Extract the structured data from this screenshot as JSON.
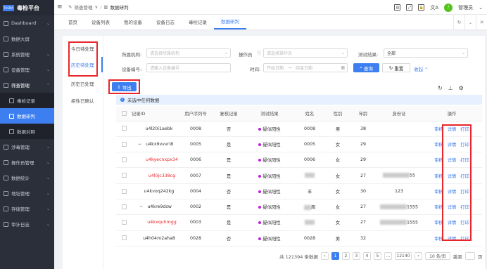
{
  "sidebar": {
    "logo_text": "TUSMA",
    "brand_title": "毒检平台",
    "items": [
      {
        "label": "Dashboard",
        "chev": "⌄"
      },
      {
        "label": "数据大屏",
        "chev": ""
      },
      {
        "label": "系统管理",
        "chev": "⌄"
      },
      {
        "label": "设备管理",
        "chev": "⌄"
      },
      {
        "label": "筛查管理",
        "chev": "⌃"
      },
      {
        "label": "毒检记录",
        "chev": ""
      },
      {
        "label": "数据研判",
        "chev": ""
      },
      {
        "label": "数据对照",
        "chev": ""
      },
      {
        "label": "涉毒管理",
        "chev": "⌄"
      },
      {
        "label": "操作员管理",
        "chev": "⌄"
      },
      {
        "label": "数据统计",
        "chev": "⌄"
      },
      {
        "label": "地址管理",
        "chev": "⌄"
      },
      {
        "label": "存储管理",
        "chev": "⌄"
      },
      {
        "label": "审计日志",
        "chev": "⌄"
      }
    ]
  },
  "topbar": {
    "crumb1": "筛查管理",
    "crumb1_arrow": "∨",
    "crumb_sep": "/",
    "crumb2": "数据研判",
    "user": "管理员",
    "user_chev": "⌄",
    "avatar_letter": "♪"
  },
  "tabs": [
    "首页",
    "设备列表",
    "我的设备",
    "设备日志",
    "毒检记录",
    "数据研判"
  ],
  "leftnav": [
    "今日待处理",
    "历史待处理",
    "历史已处理",
    "拒性已确认"
  ],
  "filters": {
    "org_label": "所属机构:",
    "org_placeholder": "请选择所属机构",
    "operator_label": "操作员",
    "operator_placeholder": "请选择操作员",
    "result_label": "测试结果:",
    "result_value": "全部",
    "device_label": "设备编号:",
    "device_placeholder": "请输入设备编号",
    "time_label": "时间:",
    "time_start": "开始日期",
    "time_sep": "→",
    "time_end": "结束日期",
    "search_btn": "查询",
    "reset_btn": "重置",
    "collapse": "收起 ⌃"
  },
  "export_btn": "导出",
  "notice": "未选中任何数据",
  "table": {
    "headers": [
      "",
      "记录ID",
      "用户序列号",
      "复核记录",
      "测试结果",
      "姓名",
      "性别",
      "年龄",
      "身份证",
      "操作"
    ],
    "rows": [
      {
        "id": "u4l20i1aebk",
        "seq": "0008",
        "review": "否",
        "result": "疑似阳性",
        "name": "0008",
        "gender": "男",
        "age": "38",
        "idcard": ""
      },
      {
        "id": "u4kx9vvvri8",
        "seq": "0005",
        "review": "是",
        "result": "疑似阳性",
        "name": "0005",
        "gender": "女",
        "age": "29",
        "idcard": ""
      },
      {
        "id": "u4kyecnxpx34",
        "seq": "0006",
        "review": "是",
        "result": "疑似阳性",
        "name": "0006",
        "gender": "女",
        "age": "29",
        "idcard": ""
      },
      {
        "id": "u4l0jc338cg",
        "seq": "0007",
        "review": "是",
        "result": "疑似阳性",
        "name": "",
        "gender": "女",
        "age": "27",
        "idcard": "55"
      },
      {
        "id": "u4kvoq242kg",
        "seq": "0004",
        "review": "否",
        "result": "疑似阳性",
        "name": "丰",
        "gender": "女",
        "age": "30",
        "idcard": "123"
      },
      {
        "id": "u4kre9dsw",
        "seq": "0002",
        "review": "是",
        "result": "疑似阳性",
        "name": "周",
        "gender": "女",
        "age": "27",
        "idcard": "1555"
      },
      {
        "id": "u4kxquhmgg",
        "seq": "0003",
        "review": "是",
        "result": "疑似阳性",
        "name": "",
        "gender": "女",
        "age": "27",
        "idcard": "1555"
      },
      {
        "id": "u4h04m2aha8",
        "seq": "0028",
        "review": "否",
        "result": "疑似阳性",
        "name": "0028",
        "gender": "男",
        "age": "32",
        "idcard": ""
      }
    ],
    "ops": [
      "审核",
      "详情",
      "打印"
    ]
  },
  "pagination": {
    "total": "共 121394 条数据",
    "pages": [
      "1",
      "2",
      "3",
      "4",
      "5",
      "...",
      "12140"
    ],
    "prev": "‹",
    "next": "›",
    "per_page": "10 条/页",
    "goto_label": "跳至",
    "goto_suffix": "页"
  }
}
